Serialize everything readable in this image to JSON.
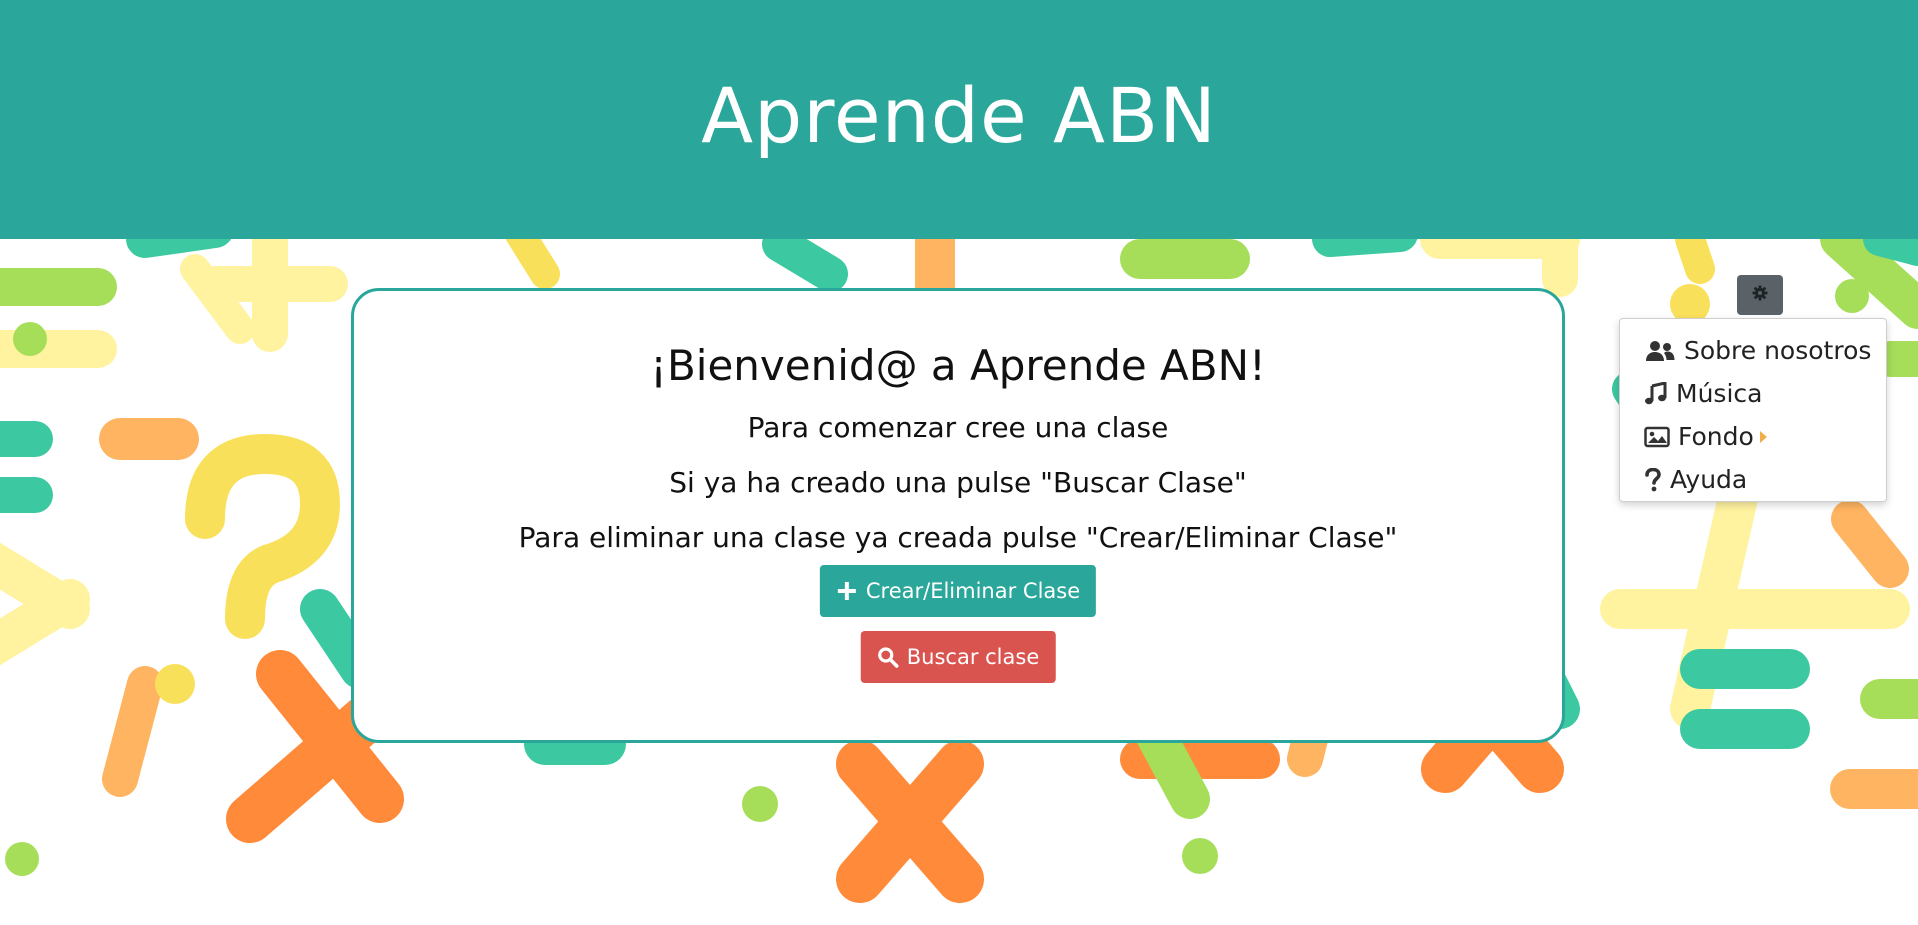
{
  "header": {
    "title": "Aprende ABN"
  },
  "card": {
    "heading": "¡Bienvenid@ a Aprende ABN!",
    "line1": "Para comenzar cree una clase",
    "line2": "Si ya ha creado una pulse \"Buscar Clase\"",
    "line3": "Para eliminar una clase ya creada pulse \"Crear/Eliminar Clase\"",
    "create_button": {
      "label": "Crear/Eliminar Clase",
      "icon": "plus-icon"
    },
    "search_button": {
      "label": "Buscar clase",
      "icon": "search-icon"
    }
  },
  "settings": {
    "icon": "gear-icon",
    "menu": [
      {
        "label": "Sobre nosotros",
        "icon": "users-icon"
      },
      {
        "label": "Música",
        "icon": "music-icon"
      },
      {
        "label": "Fondo",
        "icon": "image-icon",
        "submenu": true
      },
      {
        "label": "Ayuda",
        "icon": "question-icon"
      }
    ]
  },
  "colors": {
    "primary": "#2aa69a",
    "danger": "#d9534f",
    "settings_button": "#5a6268",
    "submenu_caret": "#f0ad4e"
  }
}
